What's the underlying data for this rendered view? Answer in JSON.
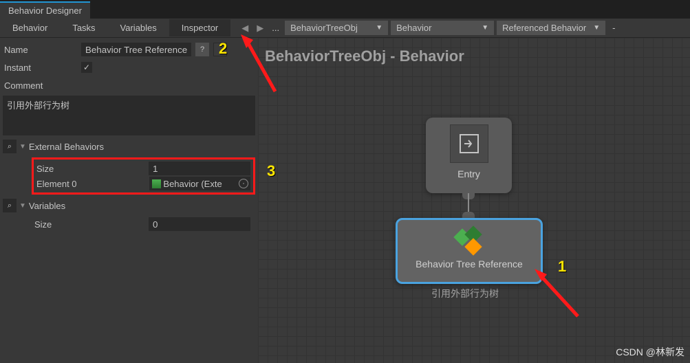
{
  "window": {
    "title": "Behavior Designer"
  },
  "toolbar": {
    "tabs": {
      "behavior": "Behavior",
      "tasks": "Tasks",
      "variables": "Variables",
      "inspector": "Inspector"
    },
    "nav": {
      "prev": "◀",
      "next": "▶",
      "dots": "..."
    },
    "dropdowns": {
      "obj": "BehaviorTreeObj",
      "beh": "Behavior",
      "ref": "Referenced Behavior"
    },
    "minus": "-"
  },
  "inspector": {
    "name": {
      "label": "Name",
      "value": "Behavior Tree Reference"
    },
    "help": "?",
    "instant": {
      "label": "Instant",
      "checked": "✓"
    },
    "comment": {
      "label": "Comment",
      "value": "引用外部行为树"
    },
    "external": {
      "header": "External Behaviors",
      "size_label": "Size",
      "size_value": "1",
      "el0_label": "Element 0",
      "el0_value": "Behavior (Exte"
    },
    "variables": {
      "header": "Variables",
      "size_label": "Size",
      "size_value": "0"
    }
  },
  "canvas": {
    "title": "BehaviorTreeObj - Behavior",
    "entry": "Entry",
    "ref": "Behavior Tree Reference",
    "ref_sub": "引用外部行为树"
  },
  "annotations": {
    "a1": "1",
    "a2": "2",
    "a3": "3"
  },
  "watermark": "CSDN @林新发"
}
